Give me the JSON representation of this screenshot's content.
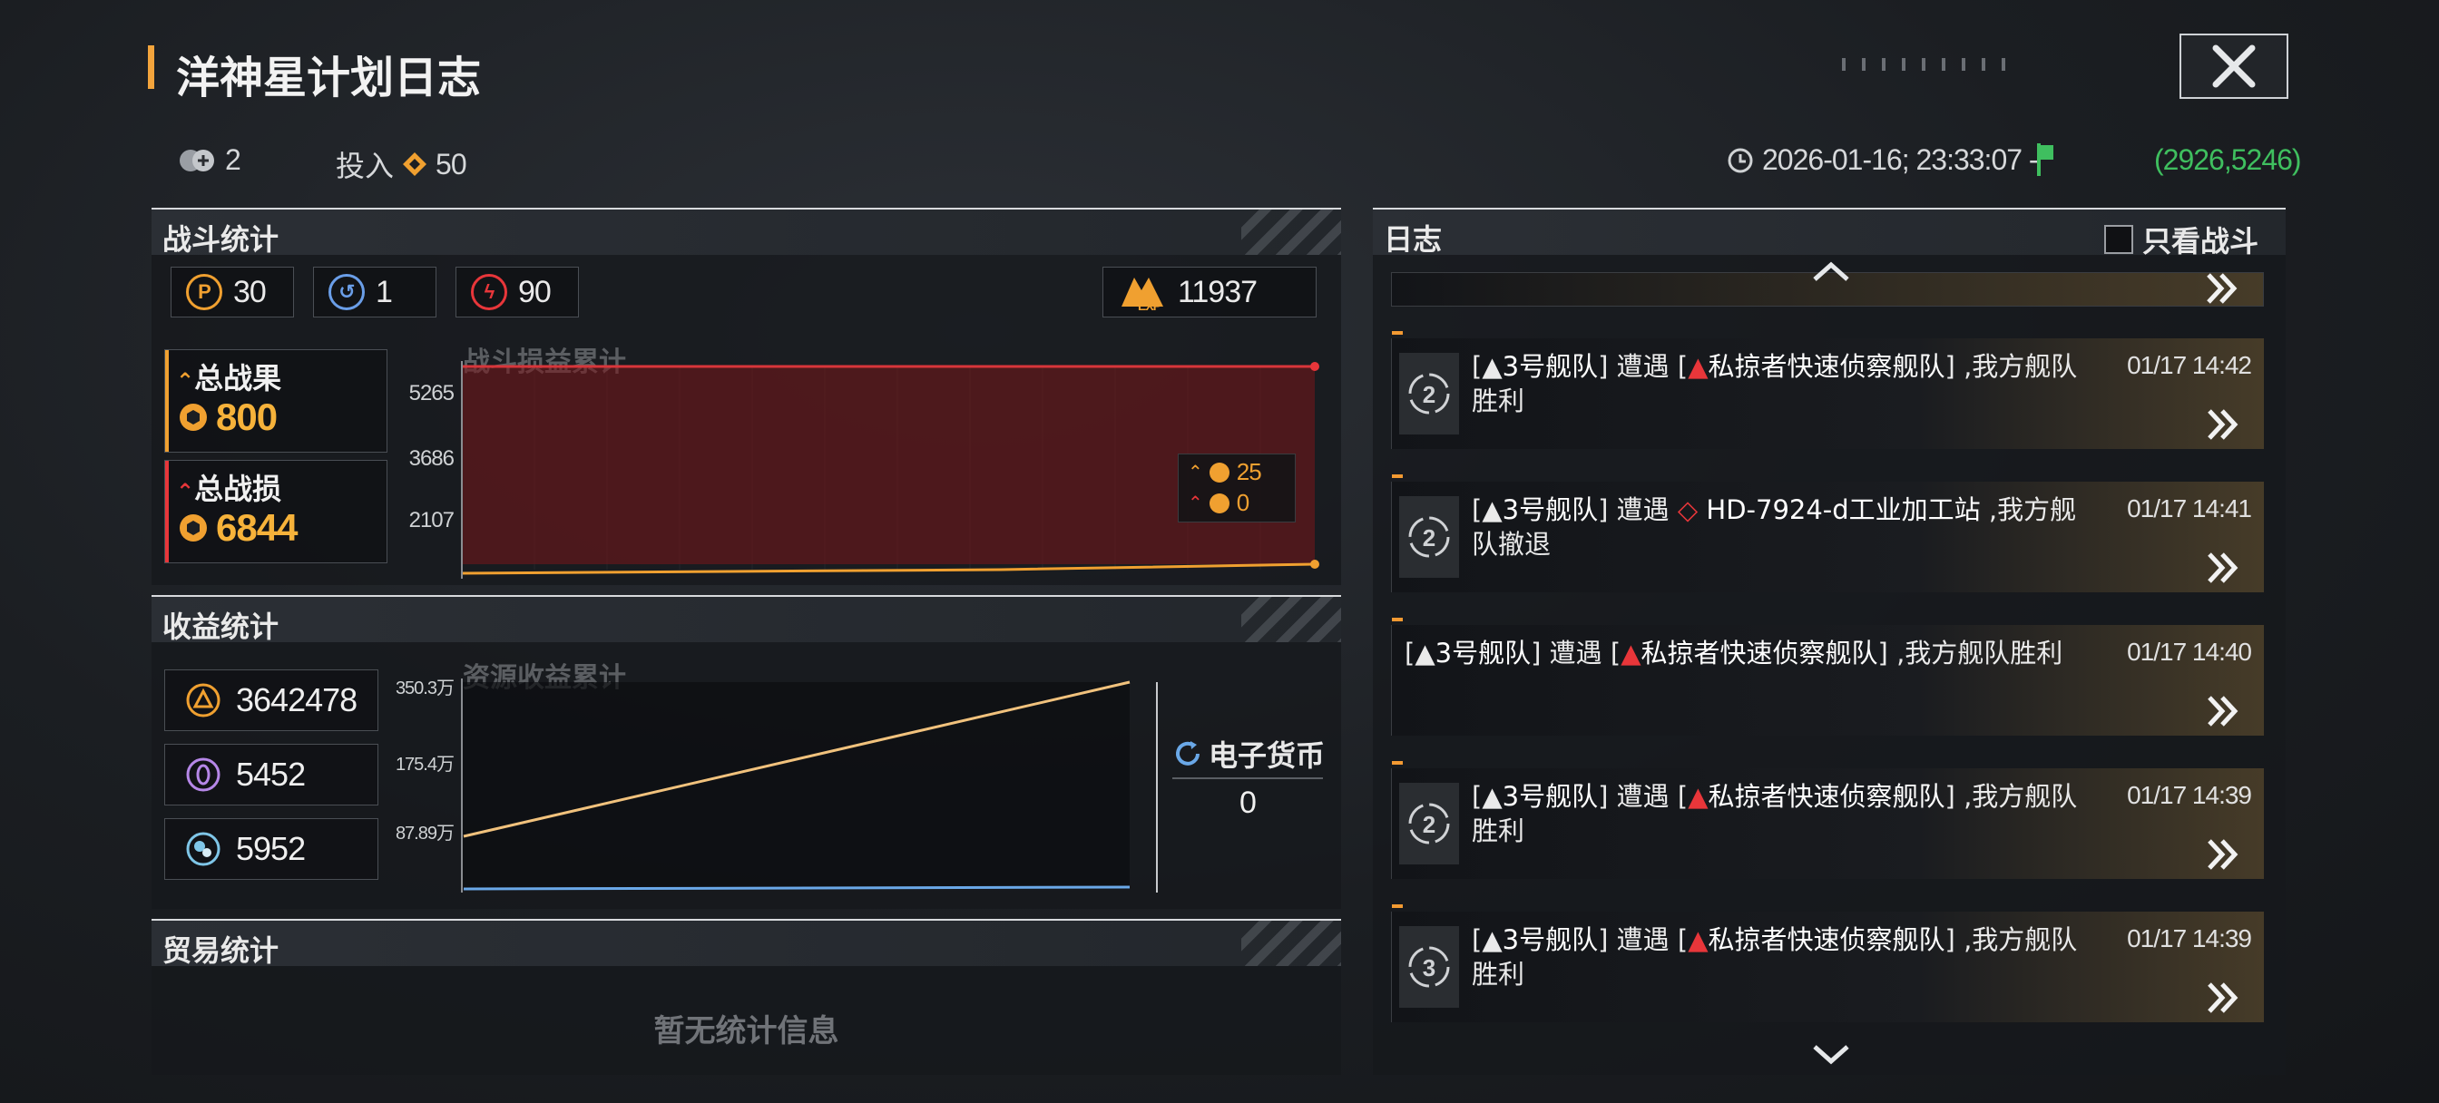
{
  "title": "洋神星计划日志",
  "info_bar": {
    "members_count": "2",
    "invest_label": "投入",
    "invest_value": "50",
    "datetime": "2026-01-16; 23:33:07 -",
    "coords": "(2926,5246)"
  },
  "combat": {
    "header": "战斗统计",
    "chips": [
      {
        "icon": "fleet-icon",
        "value": "30",
        "color": "#f0a030"
      },
      {
        "icon": "retreat-icon",
        "value": "1",
        "color": "#6a9ee8"
      },
      {
        "icon": "defeat-icon",
        "value": "90",
        "color": "#e8363a"
      }
    ],
    "exp_label": "EXP",
    "exp_value": "11937",
    "total_gain_label": "总战果",
    "total_gain_value": "800",
    "total_loss_label": "总战损",
    "total_loss_value": "6844",
    "chart_title": "战斗损益累计",
    "y_ticks": [
      "5265",
      "3686",
      "2107"
    ],
    "legend": [
      {
        "series": "gain",
        "value": "25",
        "color": "#f0a030"
      },
      {
        "series": "loss",
        "value": "0",
        "color": "#e8363a"
      }
    ]
  },
  "income": {
    "header": "收益统计",
    "items": [
      {
        "icon": "alloy-icon",
        "value": "3642478"
      },
      {
        "icon": "crystal-icon",
        "value": "5452"
      },
      {
        "icon": "gas-icon",
        "value": "5952"
      }
    ],
    "chart_title": "资源收益累计",
    "y_ticks": [
      "350.3万",
      "175.4万",
      "87.89万"
    ],
    "currency_label": "电子货币",
    "currency_value": "0"
  },
  "trade": {
    "header": "贸易统计",
    "empty_text": "暂无统计信息"
  },
  "log": {
    "header": "日志",
    "filter_label": "只看战斗",
    "entries": [
      {
        "badge": "2",
        "fleet": "3号舰队",
        "verb": "遭遇",
        "target": "私掠者快速侦察舰队",
        "result_line1": ",我方舰队",
        "result_line2": "胜利",
        "time": "01/17 14:42"
      },
      {
        "badge": "2",
        "fleet": "3号舰队",
        "verb": "遭遇",
        "target": "HD-7924-d工业加工站",
        "result_line1": ",我方舰",
        "result_line2": "队撤退",
        "time": "01/17 14:41"
      },
      {
        "badge": "",
        "fleet": "3号舰队",
        "verb": "遭遇",
        "target": "私掠者快速侦察舰队",
        "result_line1": ",我方舰队胜利",
        "result_line2": "",
        "time": "01/17 14:40"
      },
      {
        "badge": "2",
        "fleet": "3号舰队",
        "verb": "遭遇",
        "target": "私掠者快速侦察舰队",
        "result_line1": ",我方舰队",
        "result_line2": "胜利",
        "time": "01/17 14:39"
      },
      {
        "badge": "3",
        "fleet": "3号舰队",
        "verb": "遭遇",
        "target": "私掠者快速侦察舰队",
        "result_line1": ",我方舰队",
        "result_line2": "胜利",
        "time": "01/17 14:39"
      }
    ]
  },
  "chart_data": [
    {
      "type": "area",
      "title": "战斗损益累计",
      "y_ticks": [
        5265,
        3686,
        2107
      ],
      "series": [
        {
          "values": [
            6844,
            6844,
            6844,
            6844,
            6844
          ],
          "color": "#e8363a"
        },
        {
          "values": [
            0,
            200,
            400,
            600,
            800
          ],
          "color": "#f0a030"
        }
      ]
    },
    {
      "type": "line",
      "title": "资源收益累计",
      "y_ticks": [
        "350.3万",
        "175.4万",
        "87.89万"
      ],
      "series": [
        {
          "values": [
            0.3,
            3.6
          ],
          "color": "#f1c27d"
        },
        {
          "values": [
            0.02,
            0.05
          ],
          "color": "#6aa8e8"
        }
      ]
    }
  ]
}
